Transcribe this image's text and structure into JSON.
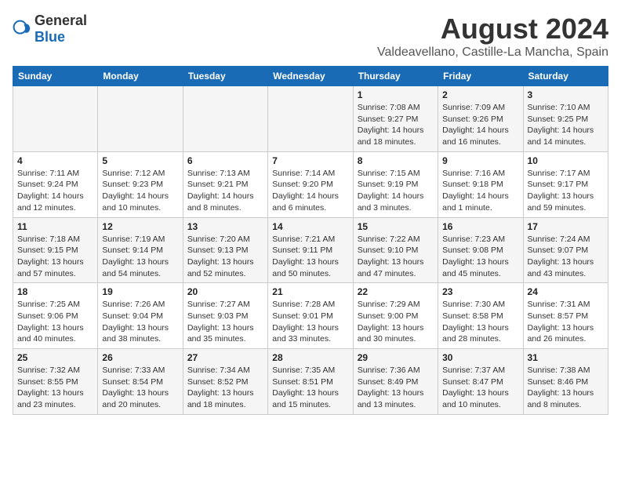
{
  "logo": {
    "general": "General",
    "blue": "Blue"
  },
  "title": "August 2024",
  "subtitle": "Valdeavellano, Castille-La Mancha, Spain",
  "days_of_week": [
    "Sunday",
    "Monday",
    "Tuesday",
    "Wednesday",
    "Thursday",
    "Friday",
    "Saturday"
  ],
  "weeks": [
    [
      {
        "day": "",
        "info": ""
      },
      {
        "day": "",
        "info": ""
      },
      {
        "day": "",
        "info": ""
      },
      {
        "day": "",
        "info": ""
      },
      {
        "day": "1",
        "info": "Sunrise: 7:08 AM\nSunset: 9:27 PM\nDaylight: 14 hours and 18 minutes."
      },
      {
        "day": "2",
        "info": "Sunrise: 7:09 AM\nSunset: 9:26 PM\nDaylight: 14 hours and 16 minutes."
      },
      {
        "day": "3",
        "info": "Sunrise: 7:10 AM\nSunset: 9:25 PM\nDaylight: 14 hours and 14 minutes."
      }
    ],
    [
      {
        "day": "4",
        "info": "Sunrise: 7:11 AM\nSunset: 9:24 PM\nDaylight: 14 hours and 12 minutes."
      },
      {
        "day": "5",
        "info": "Sunrise: 7:12 AM\nSunset: 9:23 PM\nDaylight: 14 hours and 10 minutes."
      },
      {
        "day": "6",
        "info": "Sunrise: 7:13 AM\nSunset: 9:21 PM\nDaylight: 14 hours and 8 minutes."
      },
      {
        "day": "7",
        "info": "Sunrise: 7:14 AM\nSunset: 9:20 PM\nDaylight: 14 hours and 6 minutes."
      },
      {
        "day": "8",
        "info": "Sunrise: 7:15 AM\nSunset: 9:19 PM\nDaylight: 14 hours and 3 minutes."
      },
      {
        "day": "9",
        "info": "Sunrise: 7:16 AM\nSunset: 9:18 PM\nDaylight: 14 hours and 1 minute."
      },
      {
        "day": "10",
        "info": "Sunrise: 7:17 AM\nSunset: 9:17 PM\nDaylight: 13 hours and 59 minutes."
      }
    ],
    [
      {
        "day": "11",
        "info": "Sunrise: 7:18 AM\nSunset: 9:15 PM\nDaylight: 13 hours and 57 minutes."
      },
      {
        "day": "12",
        "info": "Sunrise: 7:19 AM\nSunset: 9:14 PM\nDaylight: 13 hours and 54 minutes."
      },
      {
        "day": "13",
        "info": "Sunrise: 7:20 AM\nSunset: 9:13 PM\nDaylight: 13 hours and 52 minutes."
      },
      {
        "day": "14",
        "info": "Sunrise: 7:21 AM\nSunset: 9:11 PM\nDaylight: 13 hours and 50 minutes."
      },
      {
        "day": "15",
        "info": "Sunrise: 7:22 AM\nSunset: 9:10 PM\nDaylight: 13 hours and 47 minutes."
      },
      {
        "day": "16",
        "info": "Sunrise: 7:23 AM\nSunset: 9:08 PM\nDaylight: 13 hours and 45 minutes."
      },
      {
        "day": "17",
        "info": "Sunrise: 7:24 AM\nSunset: 9:07 PM\nDaylight: 13 hours and 43 minutes."
      }
    ],
    [
      {
        "day": "18",
        "info": "Sunrise: 7:25 AM\nSunset: 9:06 PM\nDaylight: 13 hours and 40 minutes."
      },
      {
        "day": "19",
        "info": "Sunrise: 7:26 AM\nSunset: 9:04 PM\nDaylight: 13 hours and 38 minutes."
      },
      {
        "day": "20",
        "info": "Sunrise: 7:27 AM\nSunset: 9:03 PM\nDaylight: 13 hours and 35 minutes."
      },
      {
        "day": "21",
        "info": "Sunrise: 7:28 AM\nSunset: 9:01 PM\nDaylight: 13 hours and 33 minutes."
      },
      {
        "day": "22",
        "info": "Sunrise: 7:29 AM\nSunset: 9:00 PM\nDaylight: 13 hours and 30 minutes."
      },
      {
        "day": "23",
        "info": "Sunrise: 7:30 AM\nSunset: 8:58 PM\nDaylight: 13 hours and 28 minutes."
      },
      {
        "day": "24",
        "info": "Sunrise: 7:31 AM\nSunset: 8:57 PM\nDaylight: 13 hours and 26 minutes."
      }
    ],
    [
      {
        "day": "25",
        "info": "Sunrise: 7:32 AM\nSunset: 8:55 PM\nDaylight: 13 hours and 23 minutes."
      },
      {
        "day": "26",
        "info": "Sunrise: 7:33 AM\nSunset: 8:54 PM\nDaylight: 13 hours and 20 minutes."
      },
      {
        "day": "27",
        "info": "Sunrise: 7:34 AM\nSunset: 8:52 PM\nDaylight: 13 hours and 18 minutes."
      },
      {
        "day": "28",
        "info": "Sunrise: 7:35 AM\nSunset: 8:51 PM\nDaylight: 13 hours and 15 minutes."
      },
      {
        "day": "29",
        "info": "Sunrise: 7:36 AM\nSunset: 8:49 PM\nDaylight: 13 hours and 13 minutes."
      },
      {
        "day": "30",
        "info": "Sunrise: 7:37 AM\nSunset: 8:47 PM\nDaylight: 13 hours and 10 minutes."
      },
      {
        "day": "31",
        "info": "Sunrise: 7:38 AM\nSunset: 8:46 PM\nDaylight: 13 hours and 8 minutes."
      }
    ]
  ]
}
